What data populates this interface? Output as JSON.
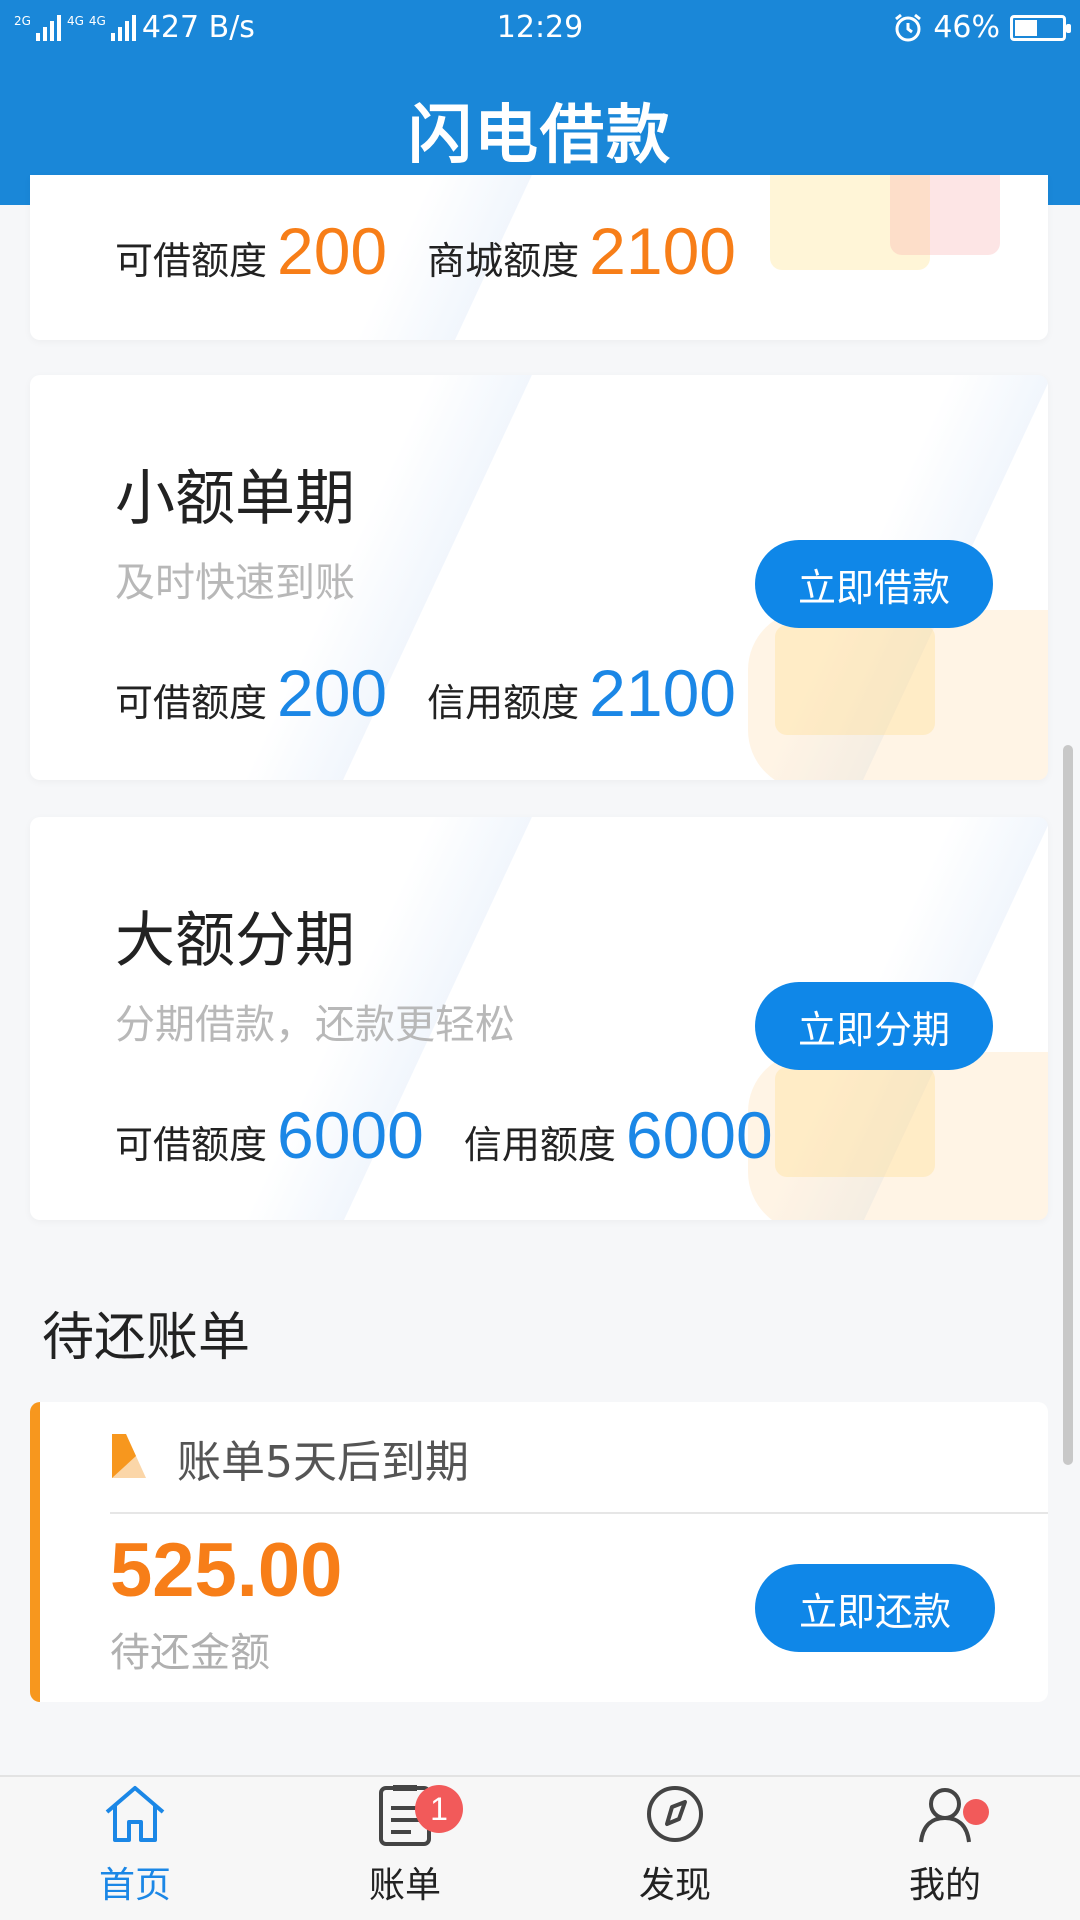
{
  "status_bar": {
    "network_1": "2G",
    "network_2": "4G",
    "network_3": "4G",
    "speed": "427 B/s",
    "time": "12:29",
    "battery": "46%",
    "alarm_icon": "alarm-icon",
    "battery_icon": "battery-icon"
  },
  "header": {
    "title": "闪电借款"
  },
  "top_card": {
    "loan_label": "可借额度",
    "loan_value": "200",
    "mall_label": "商城额度",
    "mall_value": "2100"
  },
  "small_card": {
    "title": "小额单期",
    "subtitle": "及时快速到账",
    "button": "立即借款",
    "loan_label": "可借额度",
    "loan_value": "200",
    "credit_label": "信用额度",
    "credit_value": "2100"
  },
  "large_card": {
    "title": "大额分期",
    "subtitle": "分期借款，还款更轻松",
    "button": "立即分期",
    "loan_label": "可借额度",
    "loan_value": "6000",
    "credit_label": "信用额度",
    "credit_value": "6000"
  },
  "bills": {
    "section_title": "待还账单",
    "due_text": "账单5天后到期",
    "amount": "525.00",
    "amount_label": "待还金额",
    "button": "立即还款"
  },
  "nav": {
    "items": [
      {
        "label": "首页",
        "icon": "home-icon",
        "active": true
      },
      {
        "label": "账单",
        "icon": "bill-icon",
        "badge": "1"
      },
      {
        "label": "发现",
        "icon": "compass-icon"
      },
      {
        "label": "我的",
        "icon": "user-icon",
        "dot": true
      }
    ]
  },
  "colors": {
    "primary": "#1a87d8",
    "button": "#0f87e8",
    "orange": "#f77e18",
    "blue_number": "#1b87e6",
    "badge": "#f25a5a"
  }
}
